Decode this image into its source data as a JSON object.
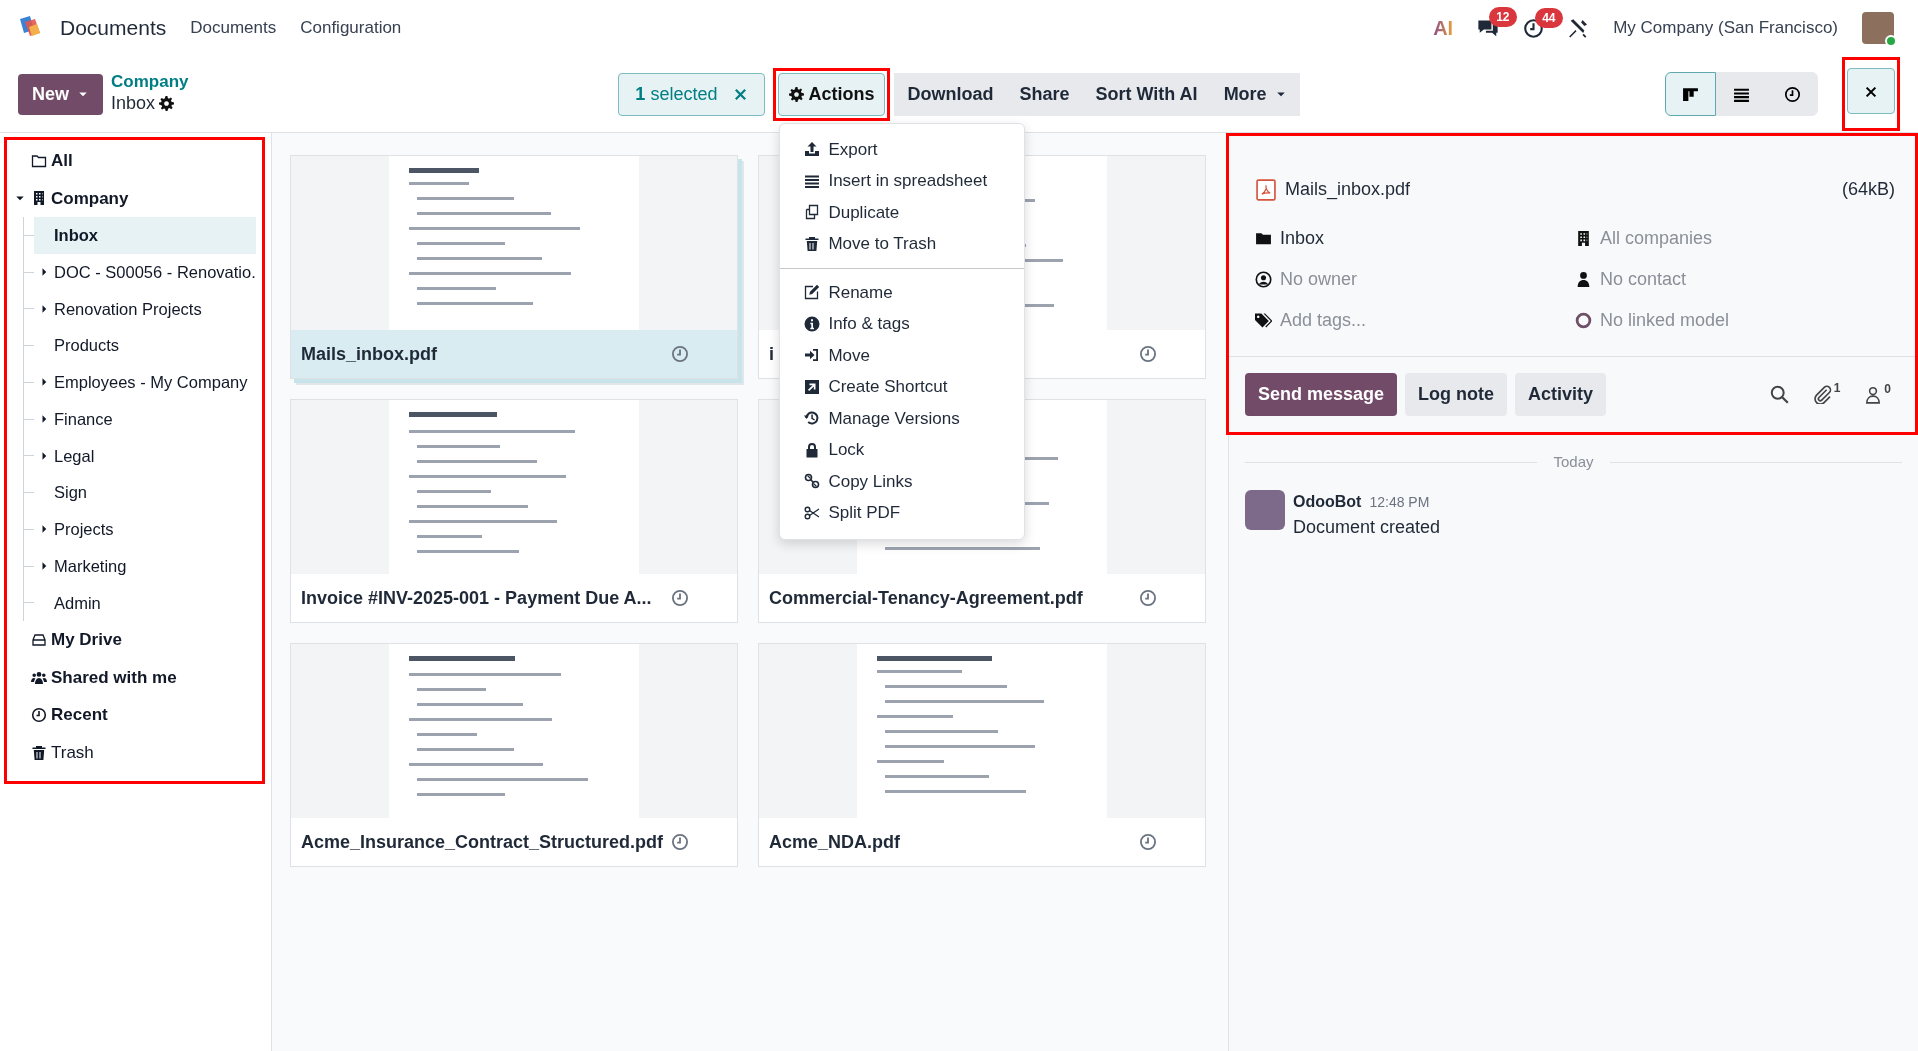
{
  "app": {
    "title": "Documents",
    "menu": [
      "Documents",
      "Configuration"
    ]
  },
  "systray": {
    "ai_label": "AI",
    "messages_count": "12",
    "activities_count": "44",
    "company": "My Company (San Francisco)"
  },
  "control": {
    "new_label": "New",
    "breadcrumb_parent": "Company",
    "breadcrumb_current": "Inbox",
    "selection": {
      "count": "1",
      "label": "selected"
    },
    "actions": {
      "label": "Actions",
      "highlighted": true,
      "expanded": true
    },
    "buttons": [
      "Download",
      "Share",
      "Sort With AI"
    ],
    "more_label": "More",
    "views": [
      {
        "kind": "kanban",
        "selected": true
      },
      {
        "kind": "list",
        "selected": false
      },
      {
        "kind": "activity",
        "selected": false
      }
    ],
    "close": {
      "highlighted": true
    }
  },
  "actions_menu": [
    [
      {
        "label": "Export",
        "kind": "upload"
      },
      {
        "label": "Insert in spreadsheet",
        "kind": "lines"
      },
      {
        "label": "Duplicate",
        "kind": "copy"
      },
      {
        "label": "Move to Trash",
        "kind": "trash"
      }
    ],
    [
      {
        "label": "Rename",
        "kind": "edit"
      },
      {
        "label": "Info & tags",
        "kind": "info"
      },
      {
        "label": "Move",
        "kind": "signin"
      },
      {
        "label": "Create Shortcut",
        "kind": "shortcut"
      },
      {
        "label": "Manage Versions",
        "kind": "history"
      },
      {
        "label": "Lock",
        "kind": "lock"
      },
      {
        "label": "Copy Links",
        "kind": "link"
      },
      {
        "label": "Split PDF",
        "kind": "scissors"
      }
    ]
  ],
  "sidebar": {
    "highlighted": true,
    "items": [
      {
        "label": "All",
        "kind": "all",
        "bold": true
      },
      {
        "label": "Company",
        "kind": "company",
        "bold": true,
        "expanded": true,
        "children": [
          {
            "label": "Inbox",
            "selected": true,
            "collapsible": false
          },
          {
            "label": "DOC - S00056 - Renovatio.",
            "selected": false,
            "collapsible": true
          },
          {
            "label": "Renovation Projects",
            "selected": false,
            "collapsible": true
          },
          {
            "label": "Products",
            "selected": false,
            "collapsible": false
          },
          {
            "label": "Employees - My Company",
            "selected": false,
            "collapsible": true
          },
          {
            "label": "Finance",
            "selected": false,
            "collapsible": true
          },
          {
            "label": "Legal",
            "selected": false,
            "collapsible": true
          },
          {
            "label": "Sign",
            "selected": false,
            "collapsible": false
          },
          {
            "label": "Projects",
            "selected": false,
            "collapsible": true
          },
          {
            "label": "Marketing",
            "selected": false,
            "collapsible": true
          },
          {
            "label": "Admin",
            "selected": false,
            "collapsible": false
          }
        ]
      },
      {
        "label": "My Drive",
        "kind": "drive",
        "bold": true
      },
      {
        "label": "Shared with me",
        "kind": "shared",
        "bold": true
      },
      {
        "label": "Recent",
        "kind": "recent",
        "bold": true
      },
      {
        "label": "Trash",
        "kind": "trash",
        "bold": false
      }
    ]
  },
  "cards": [
    {
      "title": "Mails_inbox.pdf",
      "selected": true
    },
    {
      "title": "i",
      "selected": false
    },
    {
      "title": "Invoice #INV-2025-001 - Payment Due A...",
      "selected": false
    },
    {
      "title": "Commercial-Tenancy-Agreement.pdf",
      "selected": false
    },
    {
      "title": "Acme_Insurance_Contract_Structured.pdf",
      "selected": false
    },
    {
      "title": "Acme_NDA.pdf",
      "selected": false
    }
  ],
  "details": {
    "highlighted": true,
    "file_name": "Mails_inbox.pdf",
    "file_size": "(64kB)",
    "fields": [
      {
        "kind": "folder",
        "text": "Inbox",
        "empty": false
      },
      {
        "kind": "company",
        "text": "All companies",
        "empty": true
      },
      {
        "kind": "owner",
        "text": "No owner",
        "empty": true
      },
      {
        "kind": "contact",
        "text": "No contact",
        "empty": true
      },
      {
        "kind": "tags",
        "text": "Add tags...",
        "empty": true
      },
      {
        "kind": "model",
        "text": "No linked model",
        "empty": true
      }
    ],
    "chatter_buttons": [
      {
        "label": "Send message",
        "selected": true
      },
      {
        "label": "Log note",
        "selected": false
      },
      {
        "label": "Activity",
        "selected": false
      }
    ],
    "attachments_count": "1",
    "followers_count": "0"
  },
  "chatter": {
    "date": "Today",
    "messages": [
      {
        "author": "OdooBot",
        "time": "12:48 PM",
        "text": "Document created"
      }
    ]
  }
}
